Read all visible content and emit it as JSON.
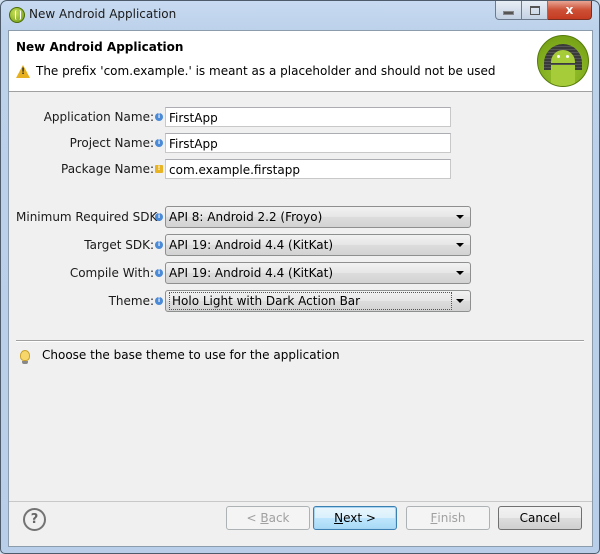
{
  "window": {
    "title": "New Android Application",
    "controls": {
      "minimize": "minimize",
      "maximize": "maximize",
      "close": "x"
    }
  },
  "header": {
    "title": "New Android Application",
    "message": "The prefix 'com.example.' is meant as a placeholder and should not be used",
    "message_icon": "warning-icon",
    "logo": "android-logo"
  },
  "fields": [
    {
      "label": "Application Name:",
      "value": "FirstApp",
      "decoration": "info"
    },
    {
      "label": "Project Name:",
      "value": "FirstApp",
      "decoration": "info"
    },
    {
      "label": "Package Name:",
      "value": "com.example.firstapp",
      "decoration": "warning"
    }
  ],
  "selects": [
    {
      "label": "Minimum Required SDK:",
      "value": "API 8: Android 2.2 (Froyo)",
      "decoration": "info"
    },
    {
      "label": "Target SDK:",
      "value": "API 19: Android 4.4 (KitKat)",
      "decoration": "info"
    },
    {
      "label": "Compile With:",
      "value": "API 19: Android 4.4 (KitKat)",
      "decoration": "info"
    },
    {
      "label": "Theme:",
      "value": "Holo Light with Dark Action Bar",
      "decoration": "info",
      "focused": true
    }
  ],
  "hint": {
    "text": "Choose the base theme to use for the application",
    "icon": "lightbulb-icon"
  },
  "buttons": {
    "help": "?",
    "back": {
      "prefix": "< ",
      "mnemonic": "B",
      "rest": "ack",
      "enabled": false
    },
    "next": {
      "mnemonic": "N",
      "rest": "ext >",
      "enabled": true
    },
    "finish": {
      "mnemonic": "F",
      "rest": "inish",
      "enabled": false
    },
    "cancel": {
      "label": "Cancel",
      "enabled": true
    }
  },
  "colors": {
    "accent": "#3c7fb1",
    "warning": "#e7b020",
    "info": "#4a8ad6",
    "android_green": "#a6cc3a"
  }
}
